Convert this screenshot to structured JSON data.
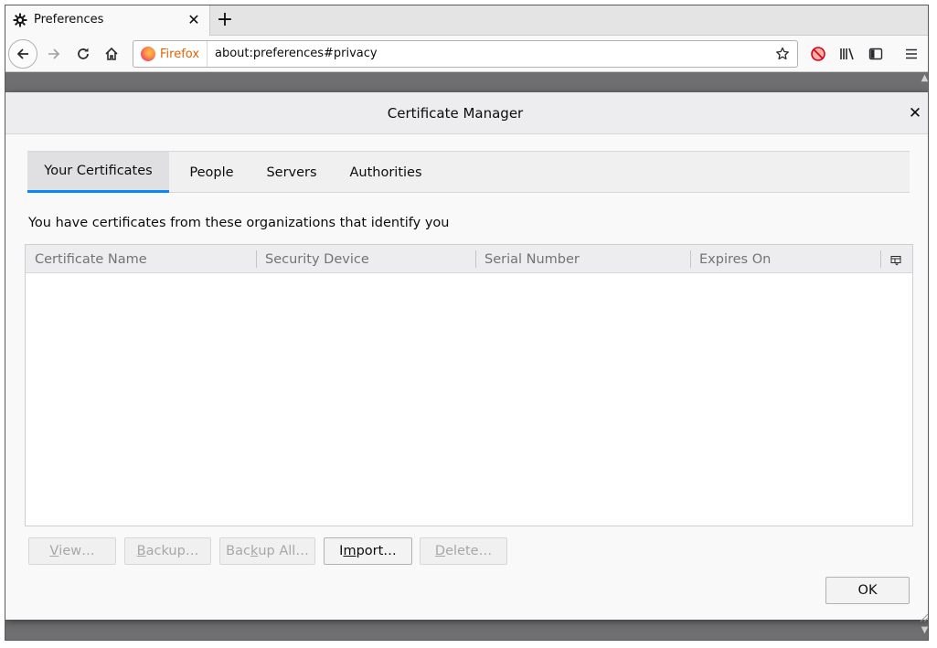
{
  "browser": {
    "tab": {
      "title": "Preferences",
      "icon": "gear-icon",
      "close_glyph": "✕"
    },
    "newtab_glyph": "+",
    "identity_label": "Firefox",
    "url": "about:preferences#privacy"
  },
  "dialog": {
    "title": "Certificate Manager",
    "close_glyph": "✕",
    "tabs": [
      {
        "label": "Your Certificates",
        "selected": true
      },
      {
        "label": "People",
        "selected": false
      },
      {
        "label": "Servers",
        "selected": false
      },
      {
        "label": "Authorities",
        "selected": false
      }
    ],
    "description": "You have certificates from these organizations that identify you",
    "columns": [
      "Certificate Name",
      "Security Device",
      "Serial Number",
      "Expires On"
    ],
    "rows": [],
    "buttons": {
      "view": {
        "pre": "",
        "accel": "V",
        "post": "iew…",
        "enabled": false
      },
      "backup": {
        "pre": "",
        "accel": "B",
        "post": "ackup…",
        "enabled": false
      },
      "backup_all": {
        "pre": "Bac",
        "accel": "k",
        "post": "up All…",
        "enabled": false
      },
      "import": {
        "pre": "I",
        "accel": "m",
        "post": "port…",
        "enabled": true
      },
      "delete": {
        "pre": "",
        "accel": "D",
        "post": "elete…",
        "enabled": false
      }
    },
    "ok_label": "OK"
  },
  "colors": {
    "accent": "#0a84ff",
    "disabled_text": "#a7a7a9",
    "firefox_label": "#e66000"
  }
}
